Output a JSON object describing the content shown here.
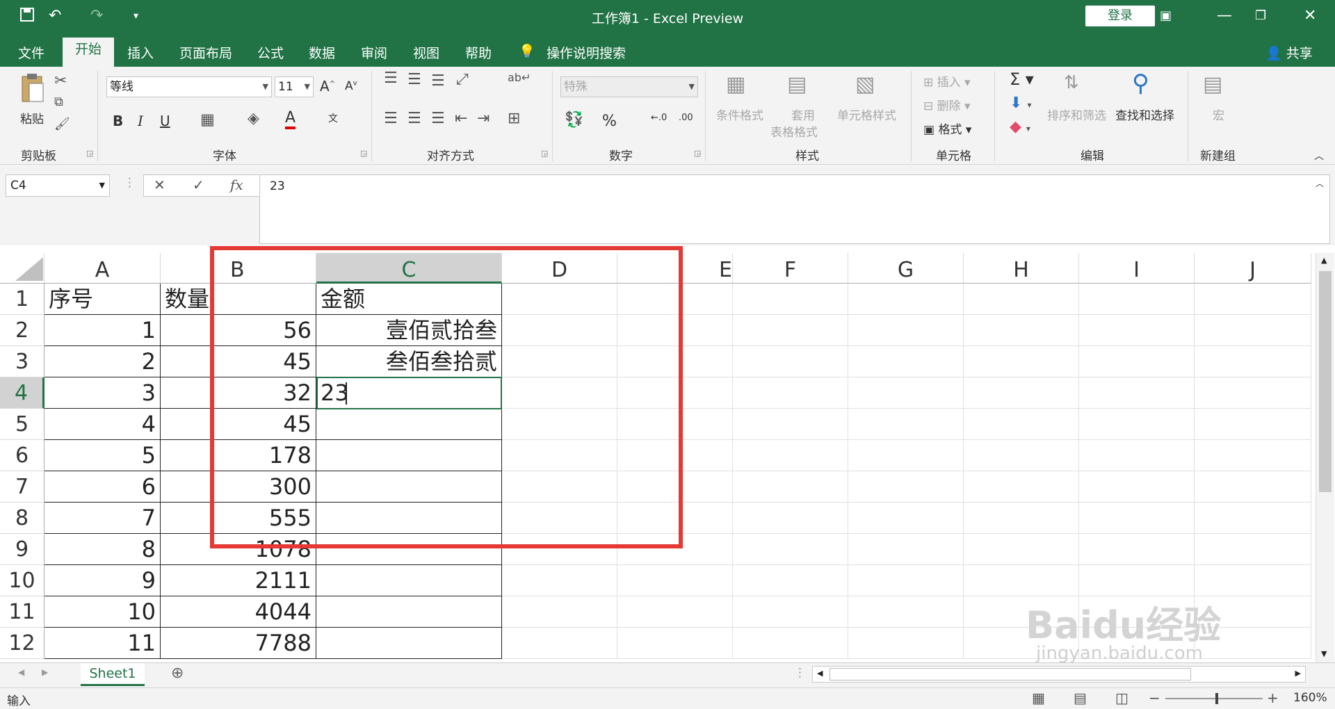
{
  "titlebar": {
    "title": "工作簿1  -  Excel Preview",
    "login_label": "登录",
    "save_icon": "save-icon",
    "undo_icon": "undo-icon",
    "redo_icon": "redo-icon"
  },
  "tabs": [
    "文件",
    "开始",
    "插入",
    "页面布局",
    "公式",
    "数据",
    "审阅",
    "视图",
    "帮助"
  ],
  "tell_me": "操作说明搜索",
  "share_label": "共享",
  "ribbon": {
    "clipboard": {
      "paste": "粘贴",
      "group": "剪贴板"
    },
    "font": {
      "name": "等线",
      "size": "11",
      "group": "字体"
    },
    "align": {
      "group": "对齐方式"
    },
    "number": {
      "format": "特殊",
      "group": "数字",
      "percent": "%"
    },
    "styles": {
      "conditional": "条件格式",
      "table1": "套用",
      "table2": "表格格式",
      "cellstyle": "单元格样式",
      "group": "样式"
    },
    "cells": {
      "insert": "插入",
      "delete": "删除",
      "format": "格式",
      "group": "单元格"
    },
    "editing": {
      "sort": "排序和筛选",
      "find": "查找和选择",
      "group": "编辑"
    },
    "macro": {
      "label": "宏",
      "group": "新建组"
    }
  },
  "formula_bar": {
    "namebox": "C4",
    "value": "23"
  },
  "columns": [
    "A",
    "B",
    "C",
    "D",
    "E",
    "F",
    "G",
    "H",
    "I",
    "J"
  ],
  "rows": [
    {
      "n": "1",
      "a": "序号",
      "b": "数量",
      "c": "金额"
    },
    {
      "n": "2",
      "a": "1",
      "b": "56",
      "c": "壹佰贰拾叁"
    },
    {
      "n": "3",
      "a": "2",
      "b": "45",
      "c": "叁佰叁拾贰"
    },
    {
      "n": "4",
      "a": "3",
      "b": "32",
      "c": "23"
    },
    {
      "n": "5",
      "a": "4",
      "b": "45",
      "c": ""
    },
    {
      "n": "6",
      "a": "5",
      "b": "178",
      "c": ""
    },
    {
      "n": "7",
      "a": "6",
      "b": "300",
      "c": ""
    },
    {
      "n": "8",
      "a": "7",
      "b": "555",
      "c": ""
    },
    {
      "n": "9",
      "a": "8",
      "b": "1078",
      "c": ""
    },
    {
      "n": "10",
      "a": "9",
      "b": "2111",
      "c": ""
    },
    {
      "n": "11",
      "a": "10",
      "b": "4044",
      "c": ""
    },
    {
      "n": "12",
      "a": "11",
      "b": "7788",
      "c": ""
    }
  ],
  "sheet_tab": "Sheet1",
  "status": {
    "mode": "输入",
    "zoom": "160%"
  },
  "watermark": {
    "brand": "Baidu经验",
    "url": "jingyan.baidu.com"
  },
  "colors": {
    "accent": "#217346",
    "highlight": "#e53935"
  }
}
